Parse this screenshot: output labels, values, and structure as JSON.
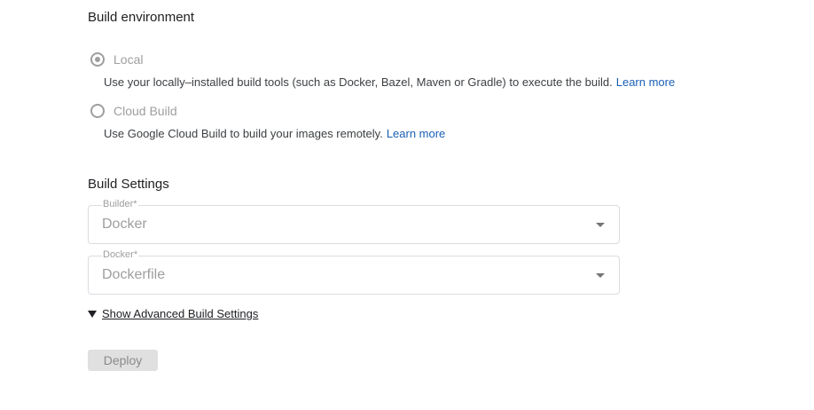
{
  "build_environment": {
    "title": "Build environment",
    "options": [
      {
        "label": "Local",
        "selected": true,
        "description": "Use your locally–installed build tools (such as Docker, Bazel, Maven or Gradle) to execute the build.",
        "link": "Learn more"
      },
      {
        "label": "Cloud Build",
        "selected": false,
        "description": "Use Google Cloud Build to build your images remotely.",
        "link": "Learn more"
      }
    ]
  },
  "build_settings": {
    "title": "Build Settings",
    "builder": {
      "label": "Builder*",
      "value": "Docker"
    },
    "docker": {
      "label": "Docker*",
      "value": "Dockerfile"
    },
    "advanced_toggle": "Show Advanced Build Settings"
  },
  "actions": {
    "deploy_label": "Deploy"
  },
  "colors": {
    "link": "#1a5fb4",
    "disabled_text": "#9e9e9e",
    "button_bg": "#e0e0e0"
  }
}
